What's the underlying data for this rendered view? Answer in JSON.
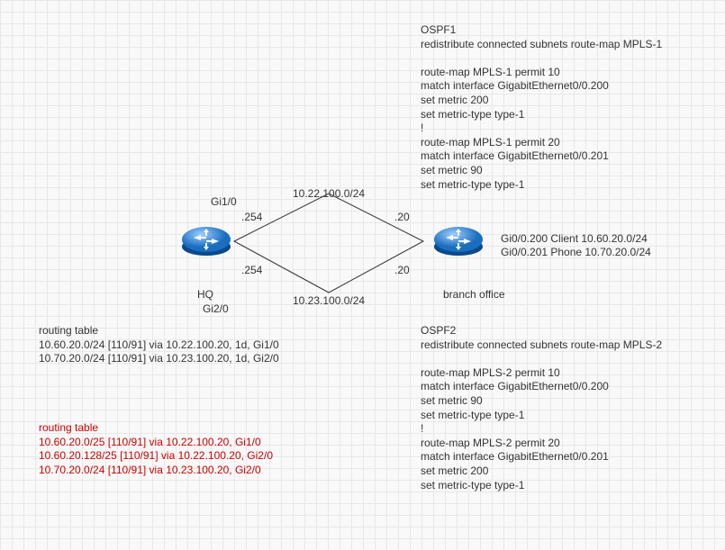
{
  "ospf1": {
    "title": "OSPF1",
    "line1": "redistribute connected subnets route-map MPLS-1",
    "line2": "route-map MPLS-1 permit 10",
    "line3": "match interface GigabitEthernet0/0.200",
    "line4": "set metric 200",
    "line5": "set metric-type type-1",
    "line6": "!",
    "line7": "route-map MPLS-1 permit 20",
    "line8": "match interface GigabitEthernet0/0.201",
    "line9": "set metric 90",
    "line10": "set metric-type type-1"
  },
  "ospf2": {
    "title": "OSPF2",
    "line1": "redistribute connected subnets route-map MPLS-2",
    "line2": "route-map MPLS-2 permit 10",
    "line3": "match interface GigabitEthernet0/0.200",
    "line4": "set metric 90",
    "line5": "set metric-type type-1",
    "line6": "!",
    "line7": "route-map MPLS-2 permit 20",
    "line8": "match interface GigabitEthernet0/0.201",
    "line9": "set metric 200",
    "line10": "set metric-type type-1"
  },
  "topology": {
    "hq_label": "HQ",
    "branch_label": "branch office",
    "gi1_0": "Gi1/0",
    "gi2_0": "Gi2/0",
    "ip254_top": ".254",
    "ip254_bot": ".254",
    "ip20_top": ".20",
    "ip20_bot": ".20",
    "subnet_top": "10.22.100.0/24",
    "subnet_bot": "10.23.100.0/24",
    "branch_if1": "Gi0/0.200 Client 10.60.20.0/24",
    "branch_if2": "Gi0/0.201 Phone 10.70.20.0/24"
  },
  "routing1": {
    "title": "routing table",
    "line1": "10.60.20.0/24 [110/91] via 10.22.100.20, 1d, Gi1/0",
    "line2": "10.70.20.0/24 [110/91] via 10.23.100.20, 1d, Gi2/0"
  },
  "routing2": {
    "title": "routing table",
    "line1": "10.60.20.0/25 [110/91] via 10.22.100.20, Gi1/0",
    "line2": "10.60.20.128/25 [110/91] via 10.22.100.20, Gi2/0",
    "line3": "10.70.20.0/24 [110/91] via 10.23.100.20, Gi2/0"
  }
}
